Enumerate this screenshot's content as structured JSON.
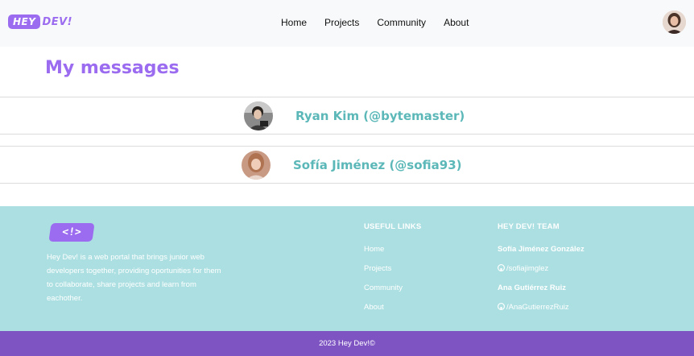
{
  "navbar": {
    "logo_badge": "HEY",
    "logo_text": "DEV!",
    "links": [
      "Home",
      "Projects",
      "Community",
      "About"
    ],
    "user_avatar": "user-photo"
  },
  "main": {
    "title": "My messages",
    "conversations": [
      {
        "name": "Ryan Kim (@bytemaster)",
        "avatar": "ryan-photo"
      },
      {
        "name": "Sofía Jiménez (@sofia93)",
        "avatar": "sofia-photo"
      }
    ]
  },
  "footer": {
    "logo_symbol": "<!>",
    "description": "Hey Dev! is a web portal that brings junior web developers together, providing oportunities for them to collaborate, share projects and learn from eachother.",
    "useful_links": {
      "heading": "USEFUL LINKS",
      "items": [
        "Home",
        "Projects",
        "Community",
        "About"
      ]
    },
    "team": {
      "heading": "HEY DEV! TEAM",
      "members": [
        {
          "name": "Sofía Jiménez González",
          "github": "/sofiajimglez"
        },
        {
          "name": "Ana Gutiérrez Ruiz",
          "github": "/AnaGutierrezRuiz"
        }
      ]
    },
    "copyright": "2023 Hey Dev!©"
  },
  "colors": {
    "brand_purple": "#9b6cf0",
    "footer_teal": "#acdfe1",
    "bottom_bar": "#7e54c3",
    "name_teal": "#5cb8b8"
  }
}
